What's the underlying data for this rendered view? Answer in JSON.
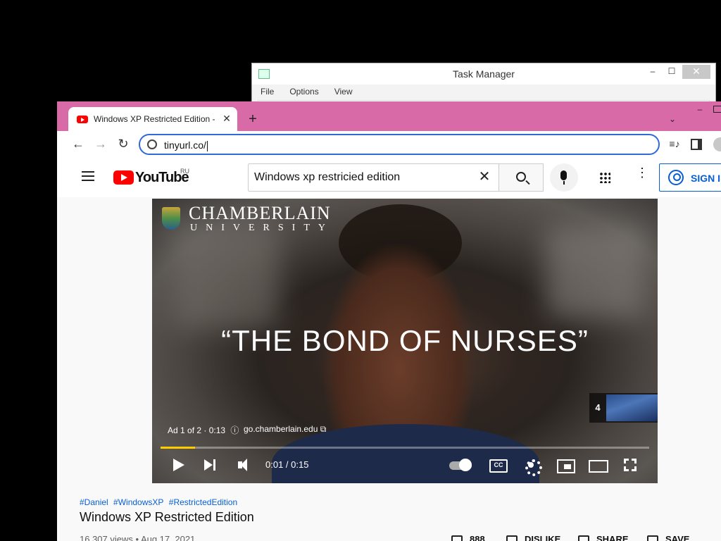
{
  "task_manager": {
    "title": "Task Manager",
    "menu": [
      "File",
      "Options",
      "View"
    ],
    "controls": {
      "minimize": "–",
      "maximize": "☐",
      "close": "✕"
    }
  },
  "browser": {
    "tab": {
      "title": "Windows XP Restricted Edition - ",
      "close": "✕",
      "favicon": "youtube-icon"
    },
    "new_tab": "+",
    "tab_search": "⌄",
    "window_controls": {
      "minimize": "–"
    },
    "nav": {
      "back": "←",
      "forward": "→",
      "reload": "↻"
    },
    "address": "tinyurl.co/",
    "toolbar_icons": {
      "media": "≡♪"
    }
  },
  "youtube": {
    "logo_text": "YouTube",
    "country": "RU",
    "search_value": "Windows xp restricied edition",
    "clear": "✕",
    "more": "⋮",
    "sign_in": "SIGN IN",
    "player": {
      "brand_name": "CHAMBERLAIN",
      "brand_sub": "UNIVERSITY",
      "quote": "“THE BOND OF NURSES”",
      "ad_label": "Ad 1 of 2 · 0:13",
      "ad_info_icon": "ⓘ",
      "ad_url": "go.chamberlain.edu ⧉",
      "skip_count": "4",
      "time": "0:01 / 0:15",
      "progress": 0.07
    },
    "hashtags": [
      "#Daniel",
      "#WindowsXP",
      "#RestrictedEdition"
    ],
    "video_title": "Windows XP Restricted Edition",
    "meta": "16,307 views • Aug 17, 2021",
    "actions": {
      "like": "888",
      "dislike": "DISLIKE",
      "share": "SHARE",
      "save": "SAVE"
    }
  }
}
